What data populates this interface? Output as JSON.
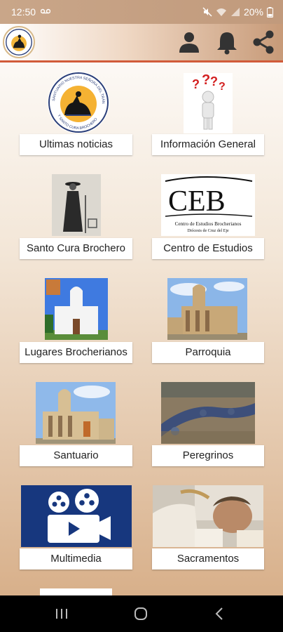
{
  "status_bar": {
    "time": "12:50",
    "battery": "20%",
    "icons": [
      "voicemail-icon",
      "mute-icon",
      "wifi-icon",
      "signal-icon",
      "battery-icon"
    ]
  },
  "app_bar": {
    "logo": "sanctuary-logo",
    "actions": [
      "user-icon",
      "bell-icon",
      "share-icon"
    ],
    "accent_color": "#d15b3a"
  },
  "grid": [
    {
      "label": "Ultimas noticias",
      "image": "sanctuary-seal"
    },
    {
      "label": "Información General",
      "image": "question-figure"
    },
    {
      "label": "Santo Cura Brochero",
      "image": "priest-photo"
    },
    {
      "label": "Centro de Estudios",
      "image": "ceb-logo"
    },
    {
      "label": "Lugares Brocherianos",
      "image": "white-church"
    },
    {
      "label": "Parroquia",
      "image": "parish-church"
    },
    {
      "label": "Santuario",
      "image": "sanctuary-church"
    },
    {
      "label": "Peregrinos",
      "image": "pilgrims"
    },
    {
      "label": "Multimedia",
      "image": "film-camera"
    },
    {
      "label": "Sacramentos",
      "image": "baptism"
    }
  ],
  "ceb_logo": {
    "letters": "CEB",
    "line1": "Centro de Estudios Brocherianos",
    "line2": "Diócesis de Cruz del Eje"
  },
  "seal_text": {
    "top": "SANTUARIO NUESTRA SEÑORA DEL TRÁNSITO",
    "bottom": "Y SANTO CURA BROCHERO"
  },
  "nav": [
    "recent-apps-button",
    "home-button",
    "back-button"
  ]
}
